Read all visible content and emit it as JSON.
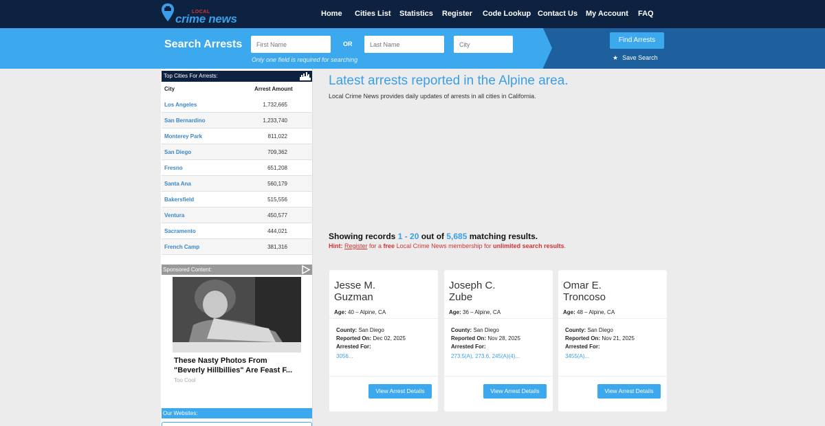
{
  "brand": {
    "small": "LOCAL",
    "big": "crime news",
    "pin_color": "#3a9ee8"
  },
  "nav": [
    "Home",
    "Cities List",
    "Statistics",
    "Register",
    "Code Lookup",
    "Contact Us",
    "My Account",
    "FAQ"
  ],
  "search": {
    "title": "Search Arrests",
    "first_placeholder": "First Name",
    "or_label": "OR",
    "last_placeholder": "Last Name",
    "city_placeholder": "City",
    "hint": "Only one field is required for searching",
    "find_label": "Find Arrests",
    "save_label": "Save Search"
  },
  "sidebar": {
    "top_cities_heading": "Top Cities For Arrests:",
    "col_city": "City",
    "col_amount": "Arrest Amount",
    "cities": [
      {
        "name": "Los Angeles",
        "amount": "1,732,665"
      },
      {
        "name": "San Bernardino",
        "amount": "1,233,740"
      },
      {
        "name": "Monterey Park",
        "amount": "811,022"
      },
      {
        "name": "San Diego",
        "amount": "709,362"
      },
      {
        "name": "Fresno",
        "amount": "651,208"
      },
      {
        "name": "Santa Ana",
        "amount": "560,179"
      },
      {
        "name": "Bakersfield",
        "amount": "515,556"
      },
      {
        "name": "Ventura",
        "amount": "450,577"
      },
      {
        "name": "Sacramento",
        "amount": "444,021"
      },
      {
        "name": "French Camp",
        "amount": "381,316"
      }
    ],
    "sponsored_heading": "Sponsored Content:",
    "ad_title": "These Nasty Photos From\n\"Beverly Hillbillies\" Are Feast F...",
    "ad_source": "Too Cool",
    "our_websites_heading": "Our Websites:"
  },
  "main": {
    "title": "Latest arrests reported in the Alpine area.",
    "subtitle": "Local Crime News provides daily updates of arrests in all cities in California.",
    "showing_prefix": "Showing records ",
    "showing_range": "1 - 20",
    "showing_mid": " out of ",
    "showing_total": "5,685",
    "showing_suffix": " matching results.",
    "hint_label": "Hint:",
    "hint_register": "Register",
    "hint_for_a": " for a ",
    "hint_free": "free",
    "hint_membership": " Local Crime News membership for ",
    "hint_unlimited": "unlimited search results",
    "hint_end": "."
  },
  "labels": {
    "age": "Age:",
    "county": "County:",
    "reported": "Reported On:",
    "arrested_for": "Arrested For:",
    "view_details": "View Arrest Details"
  },
  "cards": [
    {
      "first": "Jesse M.",
      "last": "Guzman",
      "age_loc": "40 – Alpine, CA",
      "county": "San Diego",
      "reported": "Dec 02, 2025",
      "charges": "3056..."
    },
    {
      "first": "Joseph C.",
      "last": "Zube",
      "age_loc": "36 – Alpine, CA",
      "county": "San Diego",
      "reported": "Nov 28, 2025",
      "charges": "273.5(A), 273.6, 245(A)(4)..."
    },
    {
      "first": "Omar E.",
      "last": "Troncoso",
      "age_loc": "48 – Alpine, CA",
      "county": "San Diego",
      "reported": "Nov 21, 2025",
      "charges": "3455(A)..."
    }
  ]
}
